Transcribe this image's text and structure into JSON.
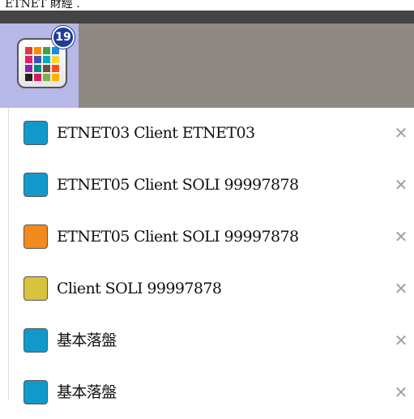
{
  "header": {
    "top_text": "ETNET 財經 .",
    "badge_count": "19",
    "tile_colors": [
      [
        "#e53935",
        "#fb8c00",
        "#43a047",
        "#1e88e5"
      ],
      [
        "#e91e63",
        "#3f51b5",
        "#00acc1",
        "#fdd835"
      ],
      [
        "#8e24aa",
        "#00897b",
        "#6d4c41",
        "#f4511e"
      ],
      [
        "#212121",
        "#d81b60",
        "#7cb342",
        "#ffb300"
      ]
    ]
  },
  "list": {
    "items": [
      {
        "label": "ETNET03 Client ETNET03",
        "color": "#1199cc",
        "close": "✕"
      },
      {
        "label": "ETNET05 Client SOLI 99997878",
        "color": "#1199cc",
        "close": "✕"
      },
      {
        "label": "ETNET05 Client SOLI 99997878",
        "color": "#f28a1e",
        "close": "✕"
      },
      {
        "label": "Client SOLI 99997878",
        "color": "#d9c23c",
        "close": "✕"
      },
      {
        "label": "基本落盤",
        "color": "#1199cc",
        "close": "✕"
      },
      {
        "label": "基本落盤",
        "color": "#1199cc",
        "close": "✕"
      }
    ]
  }
}
